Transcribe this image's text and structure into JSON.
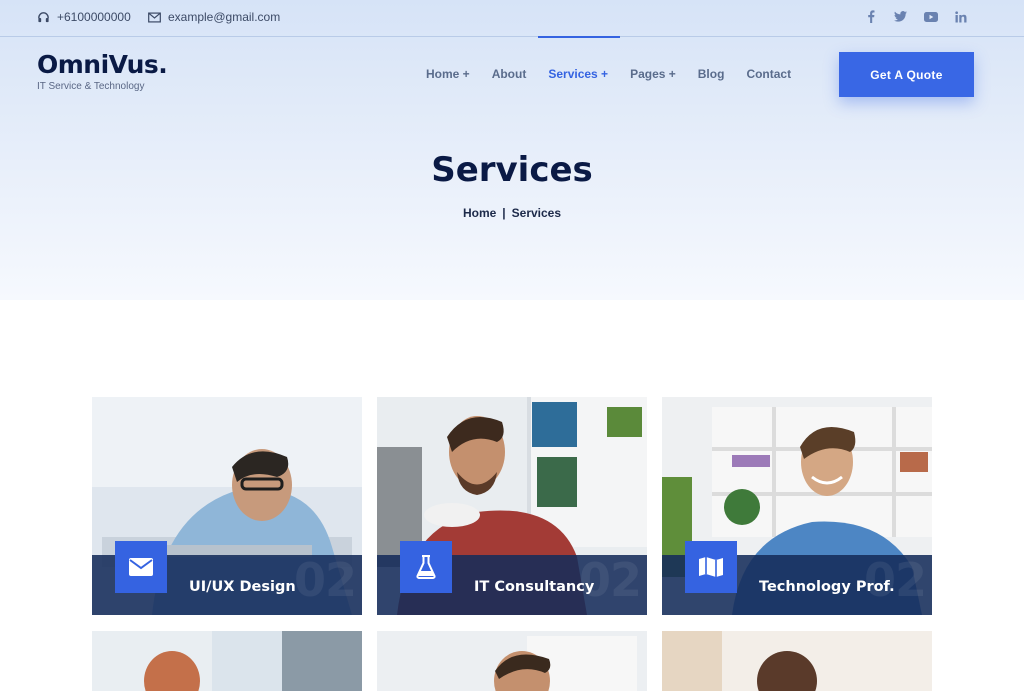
{
  "topbar": {
    "phone": "+6100000000",
    "email": "example@gmail.com",
    "social": [
      "facebook-icon",
      "twitter-icon",
      "youtube-icon",
      "linkedin-icon"
    ]
  },
  "logo": {
    "name": "OmniVus.",
    "tagline": "IT Service & Technology"
  },
  "nav": {
    "items": [
      {
        "label": "Home +"
      },
      {
        "label": "About"
      },
      {
        "label": "Services +"
      },
      {
        "label": "Pages +"
      },
      {
        "label": "Blog"
      },
      {
        "label": "Contact"
      }
    ],
    "active": "Services +",
    "cta": "Get A Quote"
  },
  "hero": {
    "title": "Services",
    "breadcrumb": [
      "Home",
      "Services"
    ],
    "separator": "|"
  },
  "services": [
    {
      "title": "UI/UX Design",
      "icon": "envelope-icon",
      "number": "02"
    },
    {
      "title": "IT Consultancy",
      "icon": "flask-icon",
      "number": "02"
    },
    {
      "title": "Technology Prof.",
      "icon": "map-icon",
      "number": "02"
    }
  ],
  "colors": {
    "accent": "#3563e1",
    "navy": "#0a1a45",
    "band": "#162c5a"
  }
}
